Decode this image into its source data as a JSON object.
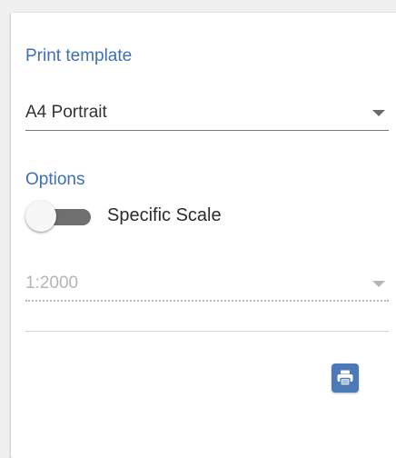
{
  "print_template": {
    "label": "Print template",
    "selected": "A4 Portrait",
    "icon": "caret-down-icon"
  },
  "options": {
    "label": "Options",
    "specific_scale": {
      "label": "Specific Scale",
      "enabled": false
    },
    "scale": {
      "selected": "1:2000",
      "disabled": true,
      "icon": "caret-down-icon"
    }
  },
  "actions": {
    "print_icon": "printer-icon"
  },
  "colors": {
    "accent": "#3f6fb7",
    "button": "#4a7ab8",
    "toggle_track": "#6f6f6f",
    "disabled_text": "#b5b5b5"
  }
}
